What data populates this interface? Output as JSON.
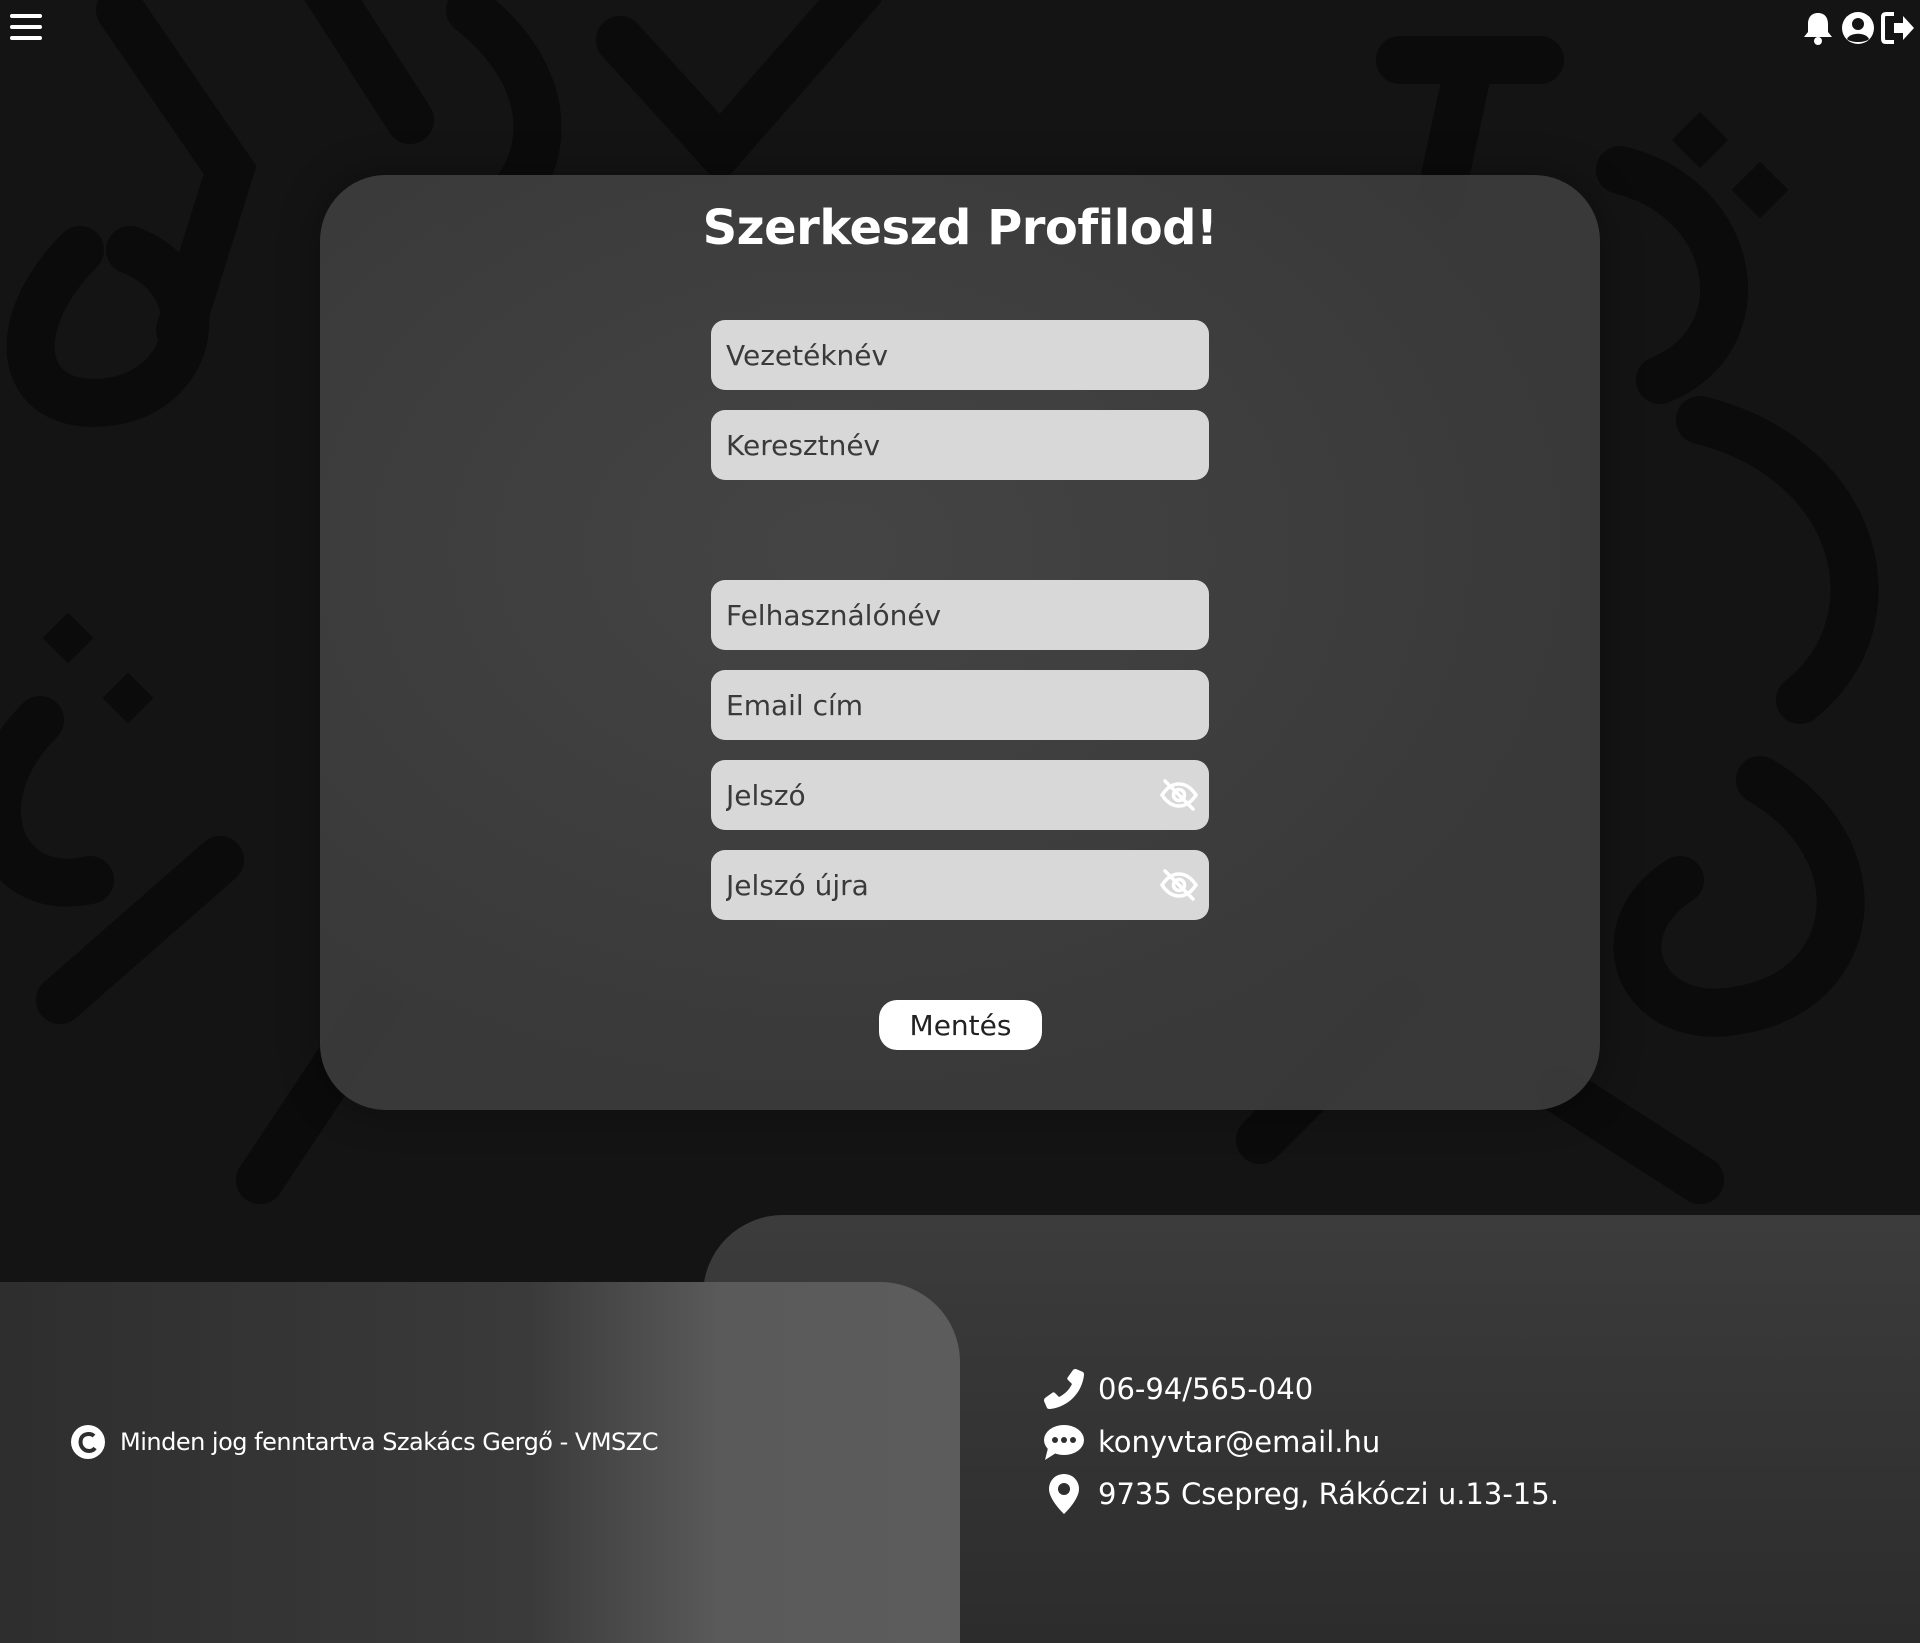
{
  "header": {
    "menu_icon": "hamburger-menu-icon",
    "icons": [
      "bell-icon",
      "user-circle-icon",
      "logout-icon"
    ]
  },
  "form": {
    "title": "Szerkeszd Profilod!",
    "fields": {
      "lastname": {
        "placeholder": "Vezetéknév"
      },
      "firstname": {
        "placeholder": "Keresztnév"
      },
      "username": {
        "placeholder": "Felhasználónév"
      },
      "email": {
        "placeholder": "Email cím"
      },
      "password": {
        "placeholder": "Jelszó"
      },
      "password_again": {
        "placeholder": "Jelszó újra"
      }
    },
    "save_label": "Mentés"
  },
  "footer": {
    "copyright": "Minden jog fenntartva Szakács Gergő - VMSZC",
    "phone": "06-94/565-040",
    "email": "konyvtar@email.hu",
    "address": "9735 Csepreg, Rákóczi u.13-15."
  },
  "colors": {
    "background": "#141414",
    "card": "#444444",
    "input": "#d8d8d8",
    "text": "#ffffff"
  }
}
